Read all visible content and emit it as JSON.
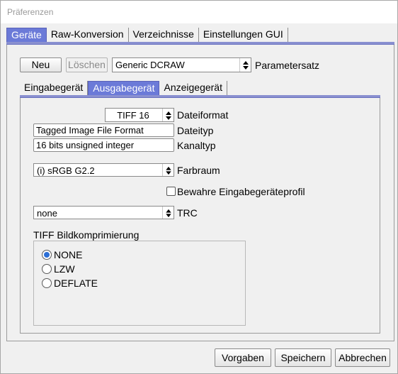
{
  "window": {
    "title": "Präferenzen"
  },
  "main_tabs": [
    {
      "label": "Geräte",
      "active": true
    },
    {
      "label": "Raw-Konversion",
      "active": false
    },
    {
      "label": "Verzeichnisse",
      "active": false
    },
    {
      "label": "Einstellungen GUI",
      "active": false
    }
  ],
  "toolbar": {
    "new_label": "Neu",
    "delete_label": "Löschen",
    "parameter_set_value": "Generic DCRAW",
    "parameter_set_label": "Parametersatz"
  },
  "sub_tabs": [
    {
      "label": "Eingabegerät",
      "active": false
    },
    {
      "label": "Ausgabegerät",
      "active": true
    },
    {
      "label": "Anzeigegerät",
      "active": false
    }
  ],
  "output": {
    "file_format_value": "TIFF 16",
    "file_format_label": "Dateiformat",
    "file_type_value": "Tagged Image File Format",
    "file_type_label": "Dateityp",
    "channel_type_value": "16 bits unsigned integer",
    "channel_type_label": "Kanaltyp",
    "color_space_value": "(i) sRGB G2.2",
    "color_space_label": "Farbraum",
    "keep_profile_label": "Bewahre Eingabegeräteprofil",
    "keep_profile_checked": false,
    "trc_value": "none",
    "trc_label": "TRC",
    "compression_title": "TIFF Bildkomprimierung",
    "compression_options": [
      {
        "label": "NONE",
        "checked": true
      },
      {
        "label": "LZW",
        "checked": false
      },
      {
        "label": "DEFLATE",
        "checked": false
      }
    ]
  },
  "footer": {
    "defaults_label": "Vorgaben",
    "save_label": "Speichern",
    "cancel_label": "Abbrechen"
  },
  "colors": {
    "active_tab": "#6b7ad8",
    "tab_line": "#8a90d0",
    "radio_dot": "#2c6fd6"
  }
}
